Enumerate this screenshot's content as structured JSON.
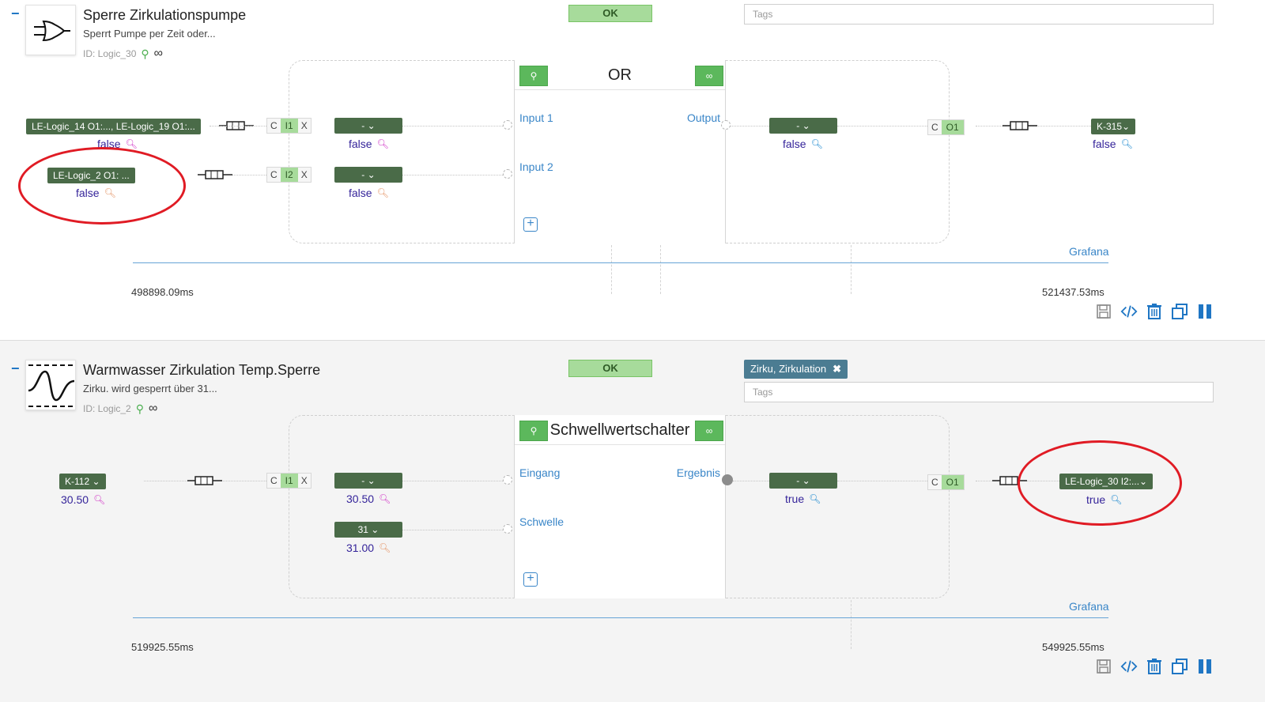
{
  "colors": {
    "accent": "#3a86c8",
    "ok": "#a7db9b",
    "dropdown": "#4a6b48",
    "green_button": "#5cb85c",
    "highlight": "#e01b24",
    "value": "#35249a"
  },
  "blocks": [
    {
      "collapse": "−",
      "icon": "or-gate-icon",
      "title": "Sperre Zirkulationspumpe",
      "description": "Sperrt Pumpe per Zeit oder...",
      "id_label": "ID: Logic_30",
      "status": "OK",
      "tags_placeholder": "Tags",
      "tag_chip": "",
      "center_title": "OR",
      "center_btn_left": "⚲",
      "center_btn_right": "∞",
      "inputs": [
        {
          "source": "LE-Logic_14 O1:..., LE-Logic_19 O1:...",
          "source_value": "false",
          "prefix": "C",
          "port": "I1",
          "suffix": "X",
          "select": "- ⌄",
          "select_value": "false",
          "label": "Input 1"
        },
        {
          "source": "LE-Logic_2 O1: ...",
          "source_value": "false",
          "prefix": "C",
          "port": "I2",
          "suffix": "X",
          "select": "- ⌄",
          "select_value": "false",
          "label": "Input 2"
        }
      ],
      "output": {
        "label": "Output",
        "select": "- ⌄",
        "select_value": "false",
        "prefix": "C",
        "port": "O1",
        "target": "K-315⌄",
        "target_value": "false"
      },
      "add_label": "+",
      "grafana": "Grafana",
      "time_start": "498898.09ms",
      "time_end": "521437.53ms"
    },
    {
      "collapse": "−",
      "icon": "threshold-icon",
      "title": "Warmwasser Zirkulation Temp.Sperre",
      "description": "Zirku. wird gesperrt über 31...",
      "id_label": "ID: Logic_2",
      "status": "OK",
      "tags_placeholder": "Tags",
      "tag_chip": "Zirku, Zirkulation",
      "tag_chip_close": "✖",
      "center_title": "Schwellwertschalter",
      "center_btn_left": "⚲",
      "center_btn_right": "∞",
      "inputs": [
        {
          "source": "K-112 ⌄",
          "source_value": "30.50",
          "prefix": "C",
          "port": "I1",
          "suffix": "X",
          "select": "- ⌄",
          "select_value": "30.50",
          "label": "Eingang"
        },
        {
          "select": "31 ⌄",
          "select_value": "31.00",
          "label": "Schwelle"
        }
      ],
      "output": {
        "label": "Ergebnis",
        "select": "- ⌄",
        "select_value": "true",
        "prefix": "C",
        "port": "O1",
        "target": "LE-Logic_30 I2:...⌄",
        "target_value": "true"
      },
      "add_label": "+",
      "grafana": "Grafana",
      "time_start": "519925.55ms",
      "time_end": "549925.55ms"
    }
  ]
}
